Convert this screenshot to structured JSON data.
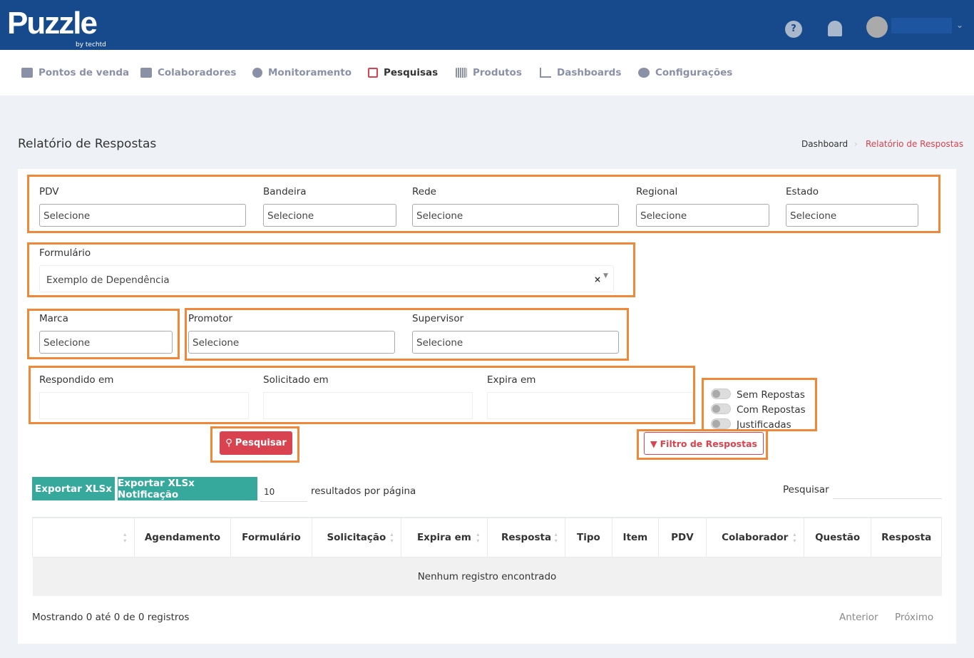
{
  "header": {
    "logo": "Puzzle",
    "logo_sub": "by techtd",
    "icons": [
      "help-icon",
      "bell-icon",
      "avatar-icon",
      "chevron-down-icon"
    ]
  },
  "nav": [
    {
      "label": "Pontos de venda",
      "icon": "store-icon"
    },
    {
      "label": "Colaboradores",
      "icon": "users-icon"
    },
    {
      "label": "Monitoramento",
      "icon": "monitor-icon"
    },
    {
      "label": "Pesquisas",
      "icon": "survey-icon",
      "active": true
    },
    {
      "label": "Produtos",
      "icon": "barcode-icon"
    },
    {
      "label": "Dashboards",
      "icon": "chart-icon"
    },
    {
      "label": "Configurações",
      "icon": "gears-icon"
    }
  ],
  "page": {
    "title": "Relatório de Respostas",
    "breadcrumb": [
      "Dashboard",
      "Relatório de Respostas"
    ]
  },
  "filters": {
    "pdv": {
      "label": "PDV",
      "value": "Selecione"
    },
    "bandeira": {
      "label": "Bandeira",
      "value": "Selecione"
    },
    "rede": {
      "label": "Rede",
      "value": "Selecione"
    },
    "regional": {
      "label": "Regional",
      "value": "Selecione"
    },
    "estado": {
      "label": "Estado",
      "value": "Selecione"
    },
    "formulario": {
      "label": "Formulário",
      "value": "Exemplo de Dependência",
      "clear": "×"
    },
    "marca": {
      "label": "Marca",
      "value": "Selecione"
    },
    "promotor": {
      "label": "Promotor",
      "value": "Selecione"
    },
    "supervisor": {
      "label": "Supervisor",
      "value": "Selecione"
    },
    "respondido": {
      "label": "Respondido em"
    },
    "solicitado": {
      "label": "Solicitado em"
    },
    "expira": {
      "label": "Expira em"
    },
    "toggles": [
      "Sem Repostas",
      "Com Repostas",
      "Justificadas"
    ],
    "search_btn": "Pesquisar",
    "filter_btn": "Filtro de Respostas"
  },
  "table": {
    "export1": "Exportar XLSx",
    "export2": "Exportar XLSx Notificação",
    "page_size": "10",
    "page_size_label": "resultados por página",
    "search_label": "Pesquisar",
    "columns": [
      "",
      "Agendamento",
      "Formulário",
      "Solicitação",
      "Expira em",
      "Resposta",
      "Tipo",
      "Item",
      "PDV",
      "Colaborador",
      "Questão",
      "Resposta"
    ],
    "empty": "Nenhum registro encontrado",
    "info": "Mostrando 0 até 0 de 0 registros",
    "prev": "Anterior",
    "next": "Próximo"
  },
  "colors": {
    "header": "#164a8c",
    "accent": "#d9434f",
    "teal": "#36a99c",
    "highlight": "#f0883a"
  }
}
